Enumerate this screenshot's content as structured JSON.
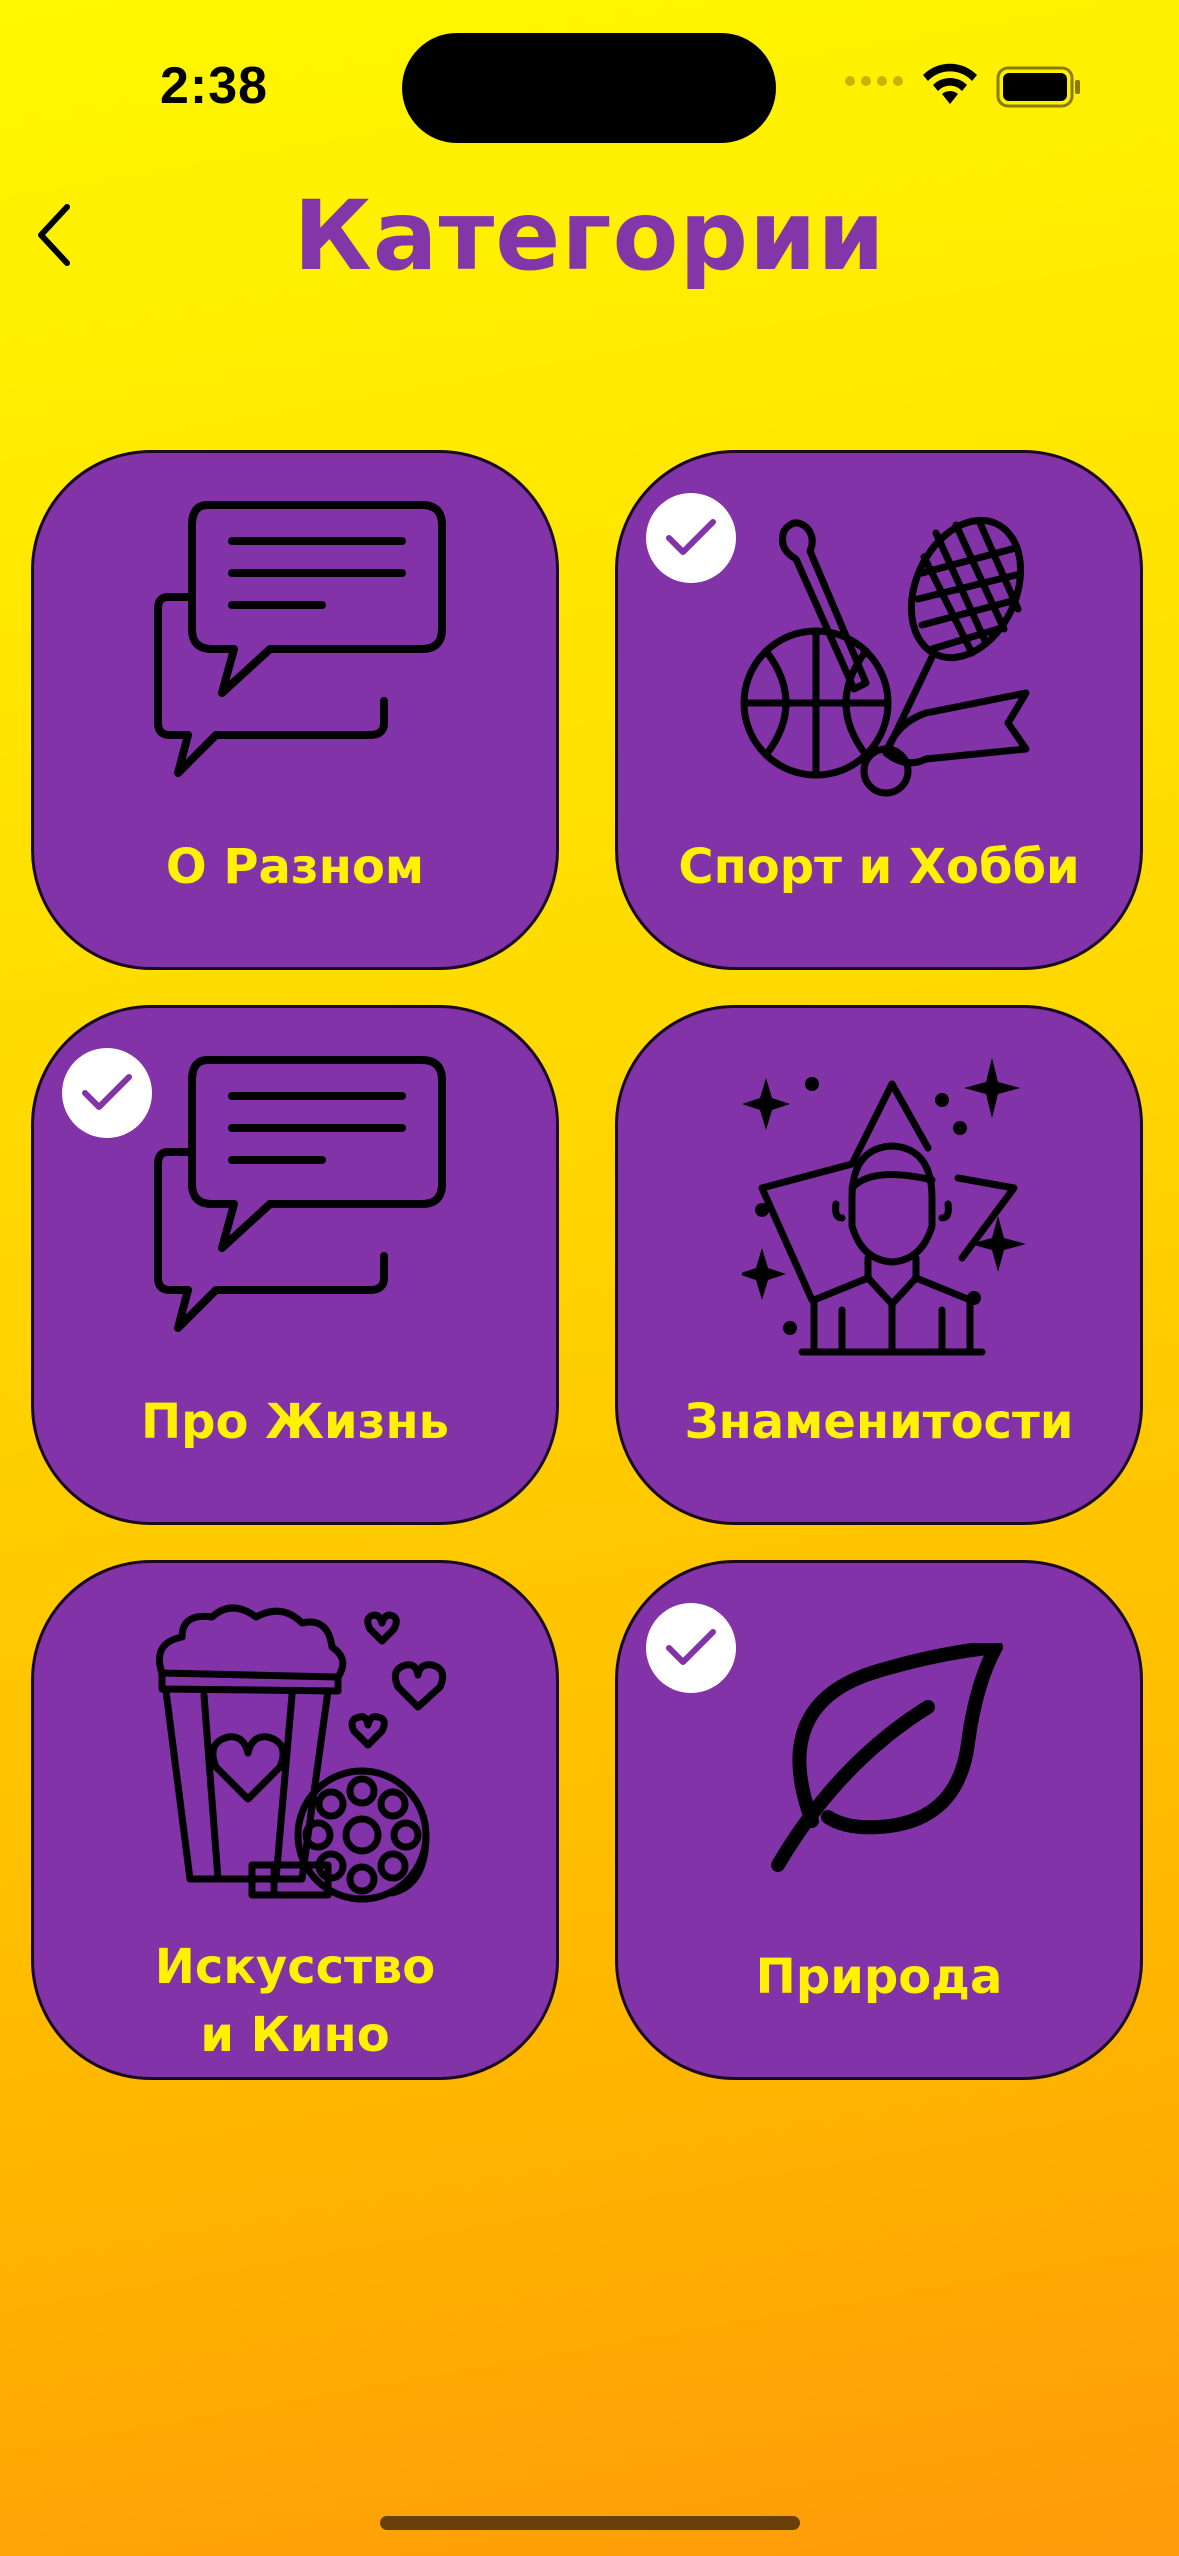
{
  "status_bar": {
    "time": "2:38"
  },
  "header": {
    "title": "Категории"
  },
  "categories": [
    {
      "label": "О Разном",
      "icon": "chat-bubbles-icon",
      "selected": false
    },
    {
      "label": "Спорт и Хобби",
      "icon": "sports-equipment-icon",
      "selected": true
    },
    {
      "label": "Про Жизнь",
      "icon": "chat-bubbles-icon",
      "selected": true
    },
    {
      "label": "Знаменитости",
      "icon": "celebrity-star-icon",
      "selected": false
    },
    {
      "label": "Искусство и Кино",
      "label_line1": "Искусство",
      "label_line2": "и Кино",
      "icon": "popcorn-film-icon",
      "selected": false
    },
    {
      "label": "Природа",
      "icon": "leaf-icon",
      "selected": true
    }
  ],
  "colors": {
    "background_top": "#fff800",
    "background_bottom": "#ff9a0a",
    "card": "#8233a8",
    "label": "#fff200",
    "title": "#8236a8",
    "check": "#ffffff"
  }
}
